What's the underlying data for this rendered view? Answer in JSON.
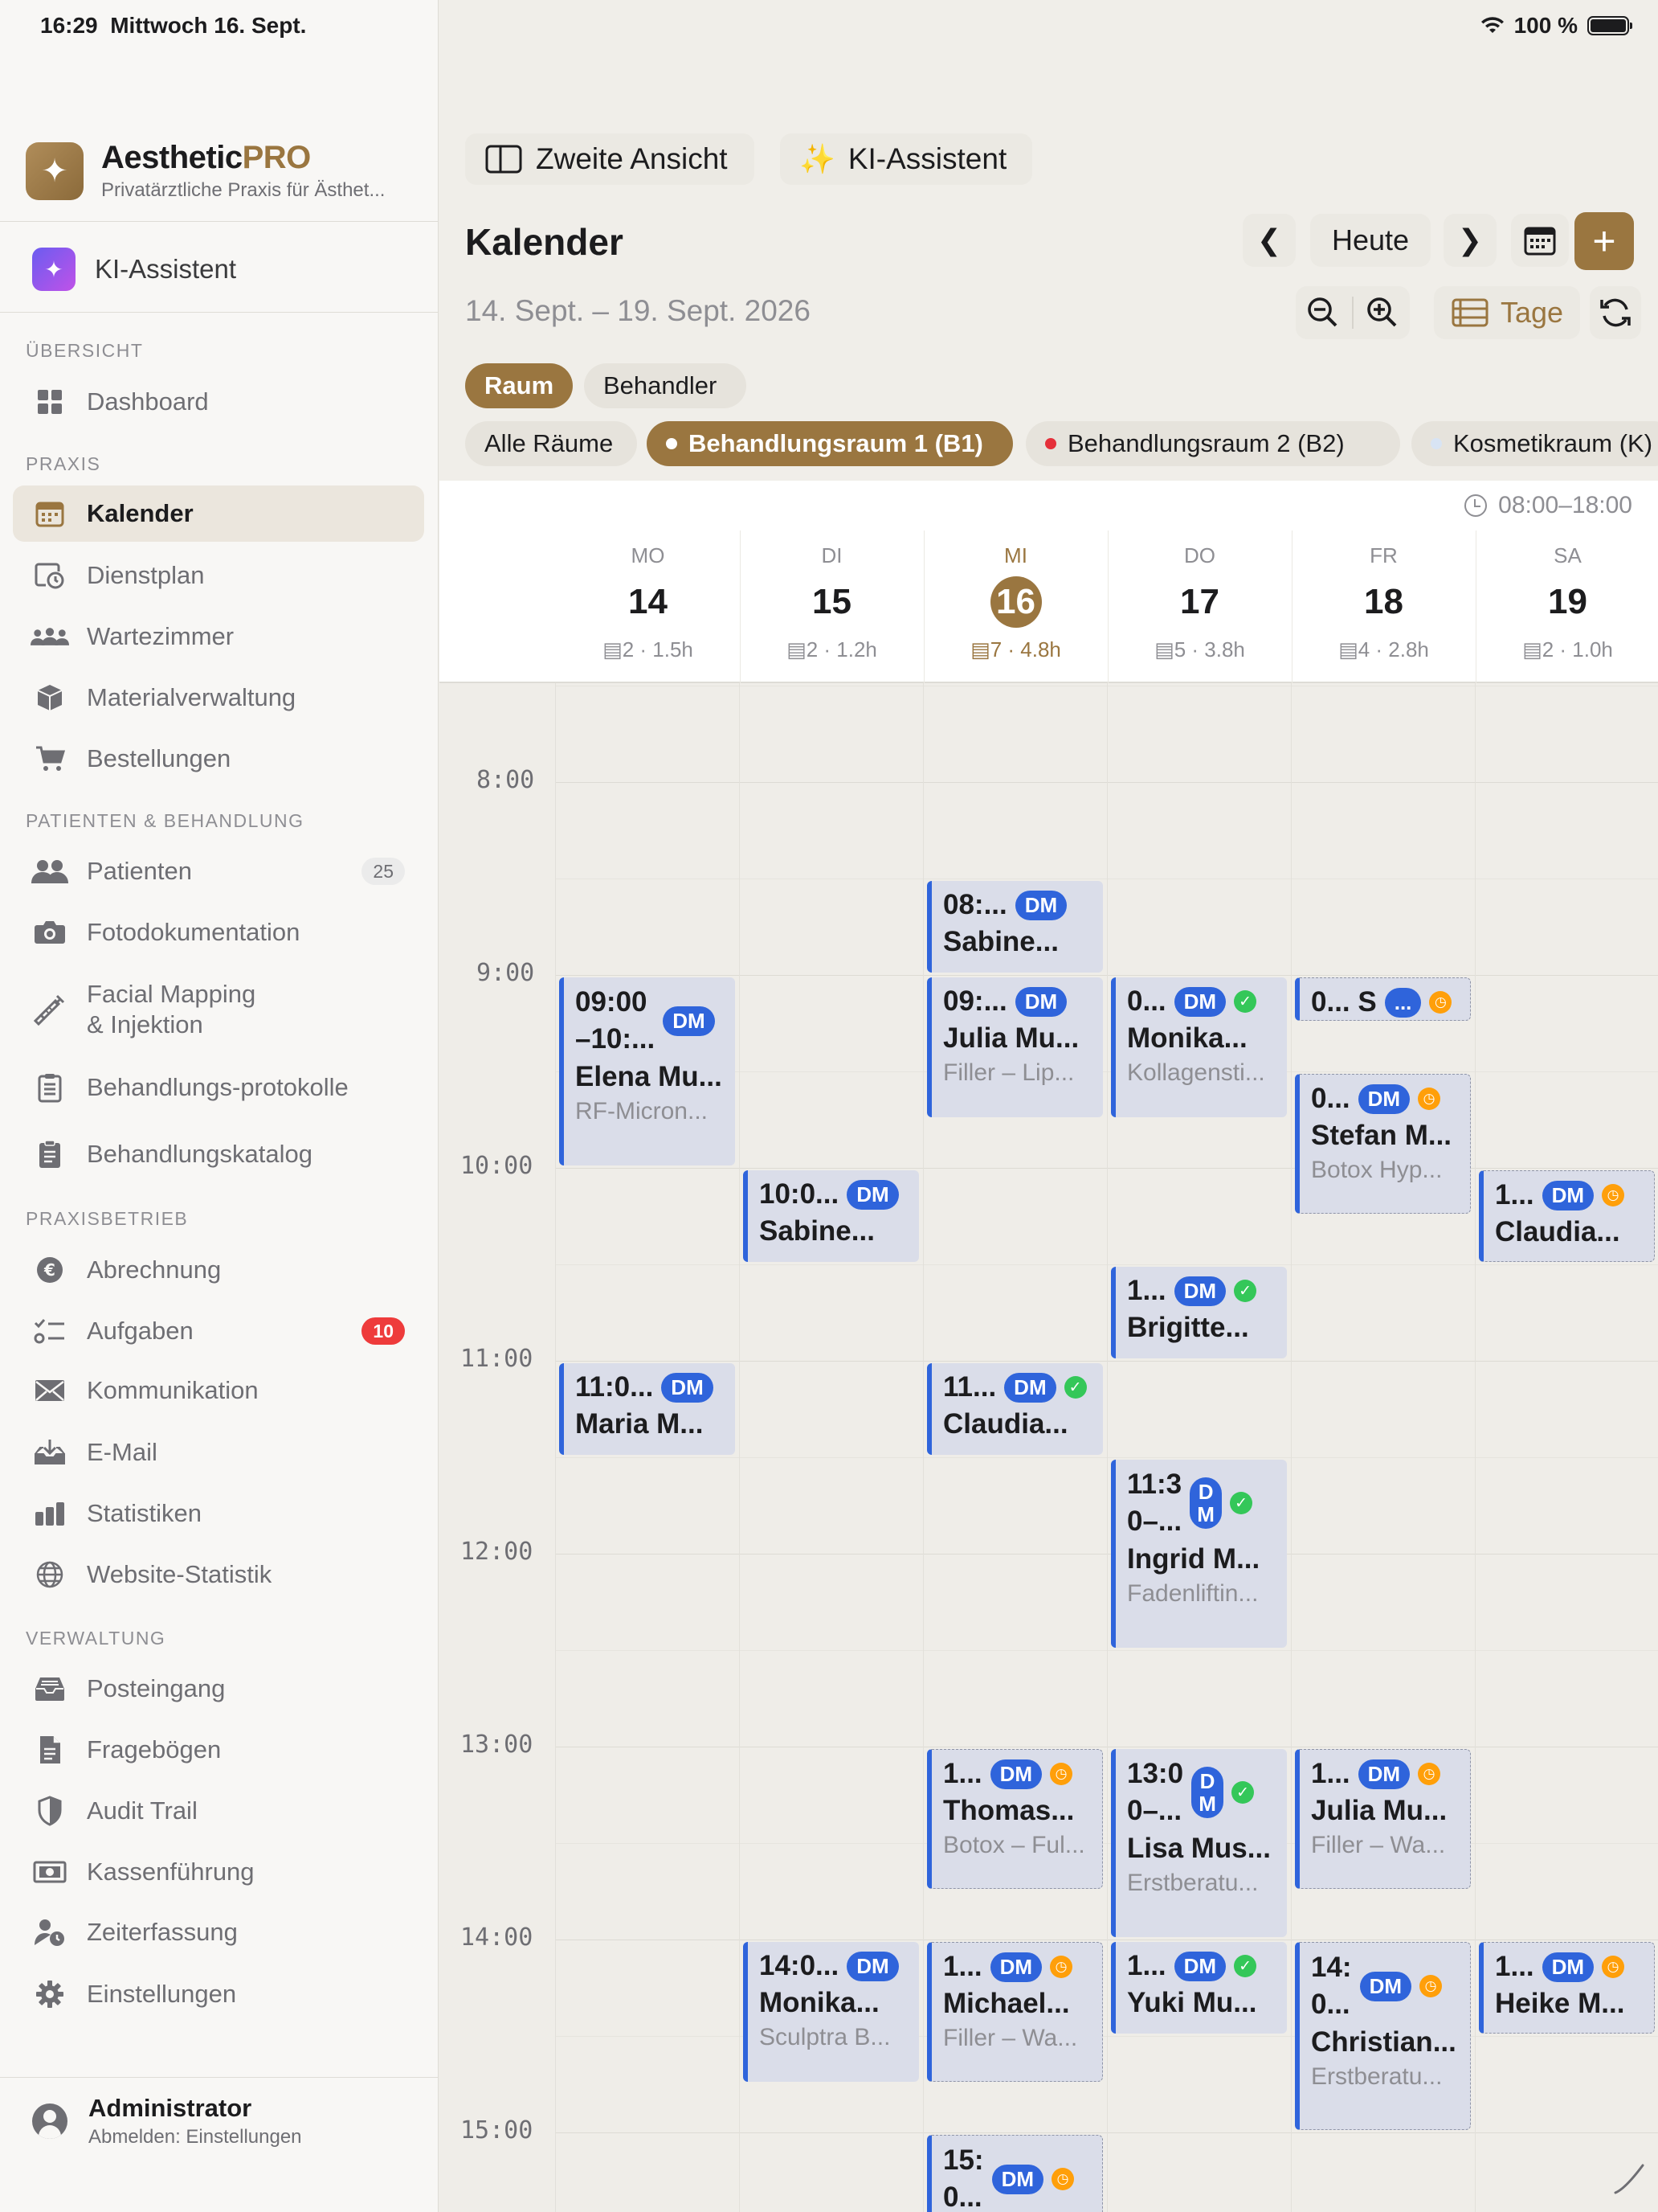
{
  "status": {
    "time": "16:29",
    "date": "Mittwoch 16. Sept.",
    "battery": "100 %"
  },
  "brand": {
    "name_a": "Aesthetic",
    "name_b": "PRO",
    "subtitle": "Privatärztliche Praxis für Ästhet..."
  },
  "ki": {
    "label": "KI-Assistent"
  },
  "sections": {
    "overview": "ÜBERSICHT",
    "praxis": "PRAXIS",
    "patients": "PATIENTEN & BEHANDLUNG",
    "betrieb": "PRAXISBETRIEB",
    "verwaltung": "VERWALTUNG"
  },
  "nav": {
    "dashboard": "Dashboard",
    "kalender": "Kalender",
    "dienstplan": "Dienstplan",
    "wartezimmer": "Wartezimmer",
    "material": "Materialverwaltung",
    "bestellungen": "Bestellungen",
    "patienten": "Patienten",
    "patienten_count": "25",
    "foto": "Fotodokumentation",
    "facial_1": "Facial Mapping",
    "facial_2": "& Injektion",
    "protokolle": "Behandlungs-protokolle",
    "katalog": "Behandlungskatalog",
    "abrechnung": "Abrechnung",
    "aufgaben": "Aufgaben",
    "aufgaben_count": "10",
    "kommunikation": "Kommunikation",
    "email": "E-Mail",
    "statistiken": "Statistiken",
    "website": "Website-Statistik",
    "posteingang": "Posteingang",
    "frageboegen": "Fragebögen",
    "audit": "Audit Trail",
    "kasse": "Kassenführung",
    "zeit": "Zeiterfassung",
    "einstellungen": "Einstellungen"
  },
  "user": {
    "name": "Administrator",
    "sub": "Abmelden: Einstellungen"
  },
  "toolbar": {
    "zweite": "Zweite Ansicht",
    "ki": "KI-Assistent",
    "today": "Heute",
    "tage": "Tage"
  },
  "calendar": {
    "title": "Kalender",
    "range": "14. Sept. – 19. Sept. 2026",
    "hours": "08:00–18:00",
    "view_modes": [
      "Raum",
      "Behandler"
    ],
    "rooms": [
      {
        "label": "Alle Räume",
        "color": ""
      },
      {
        "label": "Behandlungsraum 1 (B1)",
        "color": "#ffffff"
      },
      {
        "label": "Behandlungsraum 2 (B2)",
        "color": "#e5303a"
      },
      {
        "label": "Kosmetikraum (K)",
        "color": "#d8e4f4"
      }
    ],
    "days": [
      {
        "dow": "MO",
        "num": "14",
        "count": "2",
        "hours": "1.5h"
      },
      {
        "dow": "DI",
        "num": "15",
        "count": "2",
        "hours": "1.2h"
      },
      {
        "dow": "MI",
        "num": "16",
        "count": "7",
        "hours": "4.8h"
      },
      {
        "dow": "DO",
        "num": "17",
        "count": "5",
        "hours": "3.8h"
      },
      {
        "dow": "FR",
        "num": "18",
        "count": "4",
        "hours": "2.8h"
      },
      {
        "dow": "SA",
        "num": "19",
        "count": "2",
        "hours": "1.0h"
      }
    ],
    "time_labels": [
      "8:00",
      "9:00",
      "10:00",
      "11:00",
      "12:00",
      "13:00",
      "14:00",
      "15:00"
    ],
    "appointments": [
      {
        "day": 0,
        "start": 9.0,
        "end": 10.0,
        "time": "09:00",
        "time2": "–10:...",
        "name": "Elena Mu...",
        "treat": "RF-Micron...",
        "dm": "DM",
        "status": "",
        "dashed": false
      },
      {
        "day": 0,
        "start": 11.0,
        "end": 11.5,
        "time": "11:0...",
        "name": "Maria M...",
        "treat": "",
        "dm": "DM",
        "status": "",
        "dashed": false
      },
      {
        "day": 1,
        "start": 10.0,
        "end": 10.5,
        "time": "10:0...",
        "name": "Sabine...",
        "treat": "",
        "dm": "DM",
        "status": "",
        "dashed": false
      },
      {
        "day": 1,
        "start": 14.0,
        "end": 14.75,
        "time": "14:0...",
        "name": "Monika...",
        "treat": "Sculptra B...",
        "dm": "DM",
        "status": "",
        "dashed": false
      },
      {
        "day": 2,
        "start": 8.5,
        "end": 9.0,
        "time": "08:...",
        "name": "Sabine...",
        "treat": "",
        "dm": "DM",
        "status": "",
        "dashed": false
      },
      {
        "day": 2,
        "start": 9.0,
        "end": 9.75,
        "time": "09:...",
        "name": "Julia Mu...",
        "treat": "Filler – Lip...",
        "dm": "DM",
        "status": "",
        "dashed": false
      },
      {
        "day": 2,
        "start": 11.0,
        "end": 11.5,
        "time": "11...",
        "name": "Claudia...",
        "treat": "",
        "dm": "DM",
        "status": "ok",
        "dashed": false
      },
      {
        "day": 2,
        "start": 13.0,
        "end": 13.75,
        "time": "1...",
        "name": "Thomas...",
        "treat": "Botox – Ful...",
        "dm": "DM",
        "status": "pend",
        "dashed": true
      },
      {
        "day": 2,
        "start": 14.0,
        "end": 14.75,
        "time": "1...",
        "name": "Michael...",
        "treat": "Filler – Wa...",
        "dm": "DM",
        "status": "pend",
        "dashed": true
      },
      {
        "day": 2,
        "start": 15.0,
        "end": 15.6,
        "time": "15:",
        "time2": "0...",
        "name": "",
        "treat": "",
        "dm": "DM",
        "status": "pend",
        "dashed": true
      },
      {
        "day": 3,
        "start": 9.0,
        "end": 9.75,
        "time": "0...",
        "name": "Monika...",
        "treat": "Kollagensti...",
        "dm": "DM",
        "status": "ok",
        "dashed": false
      },
      {
        "day": 3,
        "start": 10.5,
        "end": 11.0,
        "time": "1...",
        "name": "Brigitte...",
        "treat": "",
        "dm": "DM",
        "status": "ok",
        "dashed": false
      },
      {
        "day": 3,
        "start": 11.5,
        "end": 12.5,
        "time": "11:3",
        "time2": "0–...",
        "name": "Ingrid M...",
        "treat": "Fadenliftin...",
        "dm": "DM",
        "status": "ok",
        "dashed": false,
        "dmStack": true
      },
      {
        "day": 3,
        "start": 13.0,
        "end": 14.0,
        "time": "13:0",
        "time2": "0–...",
        "name": "Lisa Mus...",
        "treat": "Erstberatu...",
        "dm": "DM",
        "status": "ok",
        "dashed": false,
        "dmStack": true
      },
      {
        "day": 3,
        "start": 14.0,
        "end": 14.5,
        "time": "1...",
        "name": "Yuki Mu...",
        "treat": "",
        "dm": "DM",
        "status": "ok",
        "dashed": false
      },
      {
        "day": 4,
        "start": 9.0,
        "end": 9.25,
        "time": "0... S",
        "name": "",
        "treat": "",
        "dm": "...",
        "status": "pend",
        "dashed": true
      },
      {
        "day": 4,
        "start": 9.5,
        "end": 10.25,
        "time": "0...",
        "name": "Stefan M...",
        "treat": "Botox Hyp...",
        "dm": "DM",
        "status": "pend",
        "dashed": true
      },
      {
        "day": 4,
        "start": 13.0,
        "end": 13.75,
        "time": "1...",
        "name": "Julia Mu...",
        "treat": "Filler – Wa...",
        "dm": "DM",
        "status": "pend",
        "dashed": true
      },
      {
        "day": 4,
        "start": 14.0,
        "end": 15.0,
        "time": "14:",
        "time2": "0...",
        "name": "Christian...",
        "treat": "Erstberatu...",
        "dm": "DM",
        "status": "pend",
        "dashed": true
      },
      {
        "day": 5,
        "start": 10.0,
        "end": 10.5,
        "time": "1...",
        "name": "Claudia...",
        "treat": "",
        "dm": "DM",
        "status": "pend",
        "dashed": true
      },
      {
        "day": 5,
        "start": 14.0,
        "end": 14.5,
        "time": "1...",
        "name": "Heike M...",
        "treat": "",
        "dm": "DM",
        "status": "pend",
        "dashed": true
      }
    ]
  },
  "colors": {
    "accent": "#9a7640",
    "dm_blue": "#2f64db",
    "ok_green": "#34c759",
    "pending_orange": "#ff9f0a",
    "badge_red": "#ee3b3b"
  }
}
